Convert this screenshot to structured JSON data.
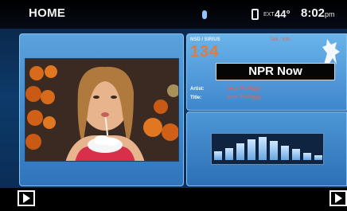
{
  "statusbar": {
    "title": "HOME",
    "bluetooth_icon": "bluetooth-icon",
    "phone_icon": "phone-icon",
    "ext_label": "EXT",
    "temperature": "44°",
    "time": "8:02",
    "time_suffix": "pm"
  },
  "video": {
    "image": "video-frame-person-drinking"
  },
  "audio": {
    "source_label": "NSD / SIRIUS",
    "genre": "Talk / Info",
    "channel_number": "134",
    "channel_name": "NPR Now",
    "artist_label": "Artist:",
    "artist_value": "Jess Prolliggs",
    "title_label": "Title:",
    "title_value": "Jess Prolliggs",
    "logo_icon": "sirius-dog-icon"
  },
  "equalizer": {
    "levels": [
      0.35,
      0.5,
      0.7,
      0.85,
      0.95,
      0.8,
      0.6,
      0.45,
      0.3,
      0.2
    ]
  },
  "bottombar": {
    "left_button": "play-icon",
    "right_button": "play-icon"
  },
  "colors": {
    "accent_orange": "#e07a40",
    "metadata_red": "#e36556",
    "panel_blue": "#3f86cc"
  }
}
